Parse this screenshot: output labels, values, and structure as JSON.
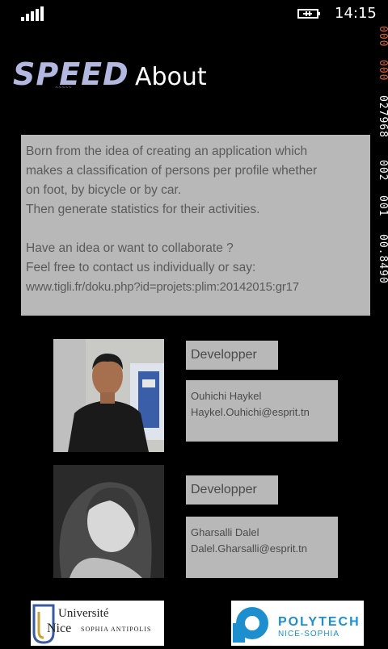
{
  "status_bar": {
    "time": "14:15"
  },
  "debug_counters": [
    "000",
    "000",
    "027968",
    "002",
    "001",
    "00.8490"
  ],
  "header": {
    "logo_text": "SPEED",
    "title": "About"
  },
  "description": {
    "lines": [
      "Born from the idea of creating an application which",
      "makes a classification of persons per profile whether",
      "on foot, by bicycle or by car.",
      "Then generate statistics for their  activities.",
      "",
      "Have an idea or want to collaborate ?",
      "Feel free to contact us individually or say:",
      "www.tigli.fr/doku.php?id=projets:plim:20142015:gr17"
    ]
  },
  "members": [
    {
      "role": "Developper",
      "name": "Ouhichi Haykel",
      "email": "Haykel.Ouhichi@esprit.tn"
    },
    {
      "role": "Developper",
      "name": "Gharsalli Dalel",
      "email": "Dalel.Gharsalli@esprit.tn"
    }
  ],
  "logos": {
    "university": {
      "line1": "Université",
      "line2": "Nice",
      "line3": "SOPHIA ANTIPOLIS"
    },
    "polytech": {
      "line1": "POLYTECH",
      "line2": "NICE-SOPHIA"
    }
  },
  "colors": {
    "panel": "#b8b8b8",
    "logo": "#b3b8e0",
    "polytech_blue": "#1d8fcf"
  }
}
